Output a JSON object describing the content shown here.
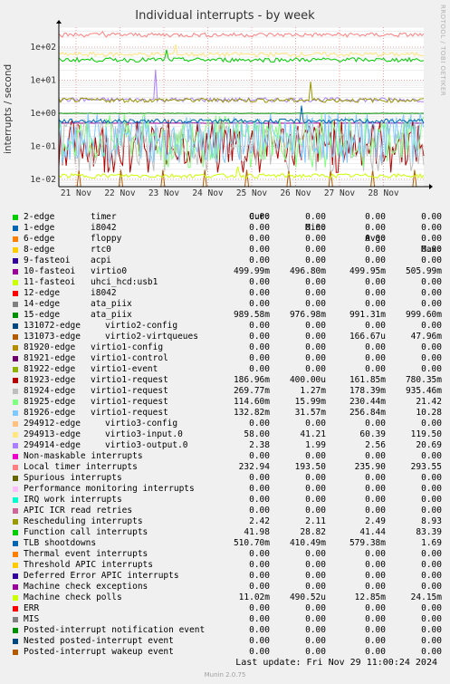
{
  "chart_data": {
    "type": "line",
    "title": "Individual interrupts - by week",
    "ylabel": "interrupts / second",
    "yscale": "log",
    "ylim": [
      0.006,
      400
    ],
    "y_ticks": [
      {
        "v": 100,
        "label": "1e+02"
      },
      {
        "v": 10,
        "label": "1e+01"
      },
      {
        "v": 1,
        "label": "1e+00"
      },
      {
        "v": 0.1,
        "label": "1e-01"
      },
      {
        "v": 0.01,
        "label": "1e-02"
      }
    ],
    "x_ticks": [
      "21 Nov",
      "22 Nov",
      "23 Nov",
      "24 Nov",
      "25 Nov",
      "26 Nov",
      "27 Nov",
      "28 Nov"
    ],
    "grid": true,
    "legend_columns": [
      "Cur:",
      "Min:",
      "Avg:",
      "Max:"
    ],
    "series": [
      {
        "name": "2-edge",
        "desc": "timer",
        "color": "#00cc00",
        "cur": "0.00",
        "min": "0.00",
        "avg": "0.00",
        "max": "0.00"
      },
      {
        "name": "1-edge",
        "desc": "i8042",
        "color": "#0066b3",
        "cur": "0.00",
        "min": "0.00",
        "avg": "0.00",
        "max": "0.00"
      },
      {
        "name": "6-edge",
        "desc": "floppy",
        "color": "#ff8000",
        "cur": "0.00",
        "min": "0.00",
        "avg": "0.00",
        "max": "0.00"
      },
      {
        "name": "8-edge",
        "desc": "rtc0",
        "color": "#ffcc00",
        "cur": "0.00",
        "min": "0.00",
        "avg": "0.00",
        "max": "0.00"
      },
      {
        "name": "9-fasteoi",
        "desc": "acpi",
        "color": "#330099",
        "cur": "0.00",
        "min": "0.00",
        "avg": "0.00",
        "max": "0.00"
      },
      {
        "name": "10-fasteoi",
        "desc": "virtio0",
        "color": "#990099",
        "cur": "499.99m",
        "min": "496.80m",
        "avg": "499.95m",
        "max": "505.99m"
      },
      {
        "name": "11-fasteoi",
        "desc": "uhci_hcd:usb1",
        "color": "#ccff00",
        "cur": "0.00",
        "min": "0.00",
        "avg": "0.00",
        "max": "0.00"
      },
      {
        "name": "12-edge",
        "desc": "i8042",
        "color": "#ff0000",
        "cur": "0.00",
        "min": "0.00",
        "avg": "0.00",
        "max": "0.00"
      },
      {
        "name": "14-edge",
        "desc": "ata_piix",
        "color": "#808080",
        "cur": "0.00",
        "min": "0.00",
        "avg": "0.00",
        "max": "0.00"
      },
      {
        "name": "15-edge",
        "desc": "ata_piix",
        "color": "#008f00",
        "cur": "989.58m",
        "min": "976.98m",
        "avg": "991.31m",
        "max": "999.60m"
      },
      {
        "name": "131072-edge",
        "desc": "virtio2-config",
        "color": "#00487d",
        "cur": "0.00",
        "min": "0.00",
        "avg": "0.00",
        "max": "0.00"
      },
      {
        "name": "131073-edge",
        "desc": "virtio2-virtqueues",
        "color": "#b35a00",
        "cur": "0.00",
        "min": "0.00",
        "avg": "166.67u",
        "max": "47.96m"
      },
      {
        "name": "81920-edge",
        "desc": "virtio1-config",
        "color": "#b38f00",
        "cur": "0.00",
        "min": "0.00",
        "avg": "0.00",
        "max": "0.00"
      },
      {
        "name": "81921-edge",
        "desc": "virtio1-control",
        "color": "#6b006b",
        "cur": "0.00",
        "min": "0.00",
        "avg": "0.00",
        "max": "0.00"
      },
      {
        "name": "81922-edge",
        "desc": "virtio1-event",
        "color": "#8fb300",
        "cur": "0.00",
        "min": "0.00",
        "avg": "0.00",
        "max": "0.00"
      },
      {
        "name": "81923-edge",
        "desc": "virtio1-request",
        "color": "#b30000",
        "cur": "186.96m",
        "min": "400.00u",
        "avg": "161.85m",
        "max": "780.35m"
      },
      {
        "name": "81924-edge",
        "desc": "virtio1-request",
        "color": "#bebebe",
        "cur": "269.77m",
        "min": "1.27m",
        "avg": "178.39m",
        "max": "935.46m"
      },
      {
        "name": "81925-edge",
        "desc": "virtio1-request",
        "color": "#80ff80",
        "cur": "114.60m",
        "min": "15.99m",
        "avg": "230.44m",
        "max": "21.42"
      },
      {
        "name": "81926-edge",
        "desc": "virtio1-request",
        "color": "#80c9ff",
        "cur": "132.82m",
        "min": "31.57m",
        "avg": "256.84m",
        "max": "10.28"
      },
      {
        "name": "294912-edge",
        "desc": "virtio3-config",
        "color": "#ffc080",
        "cur": "0.00",
        "min": "0.00",
        "avg": "0.00",
        "max": "0.00"
      },
      {
        "name": "294913-edge",
        "desc": "virtio3-input.0",
        "color": "#ffe680",
        "cur": "58.00",
        "min": "41.21",
        "avg": "60.39",
        "max": "119.50"
      },
      {
        "name": "294914-edge",
        "desc": "virtio3-output.0",
        "color": "#aa80ff",
        "cur": "2.38",
        "min": "1.99",
        "avg": "2.56",
        "max": "20.69"
      },
      {
        "name": "Non-maskable interrupts",
        "desc": "",
        "color": "#ee00cc",
        "cur": "0.00",
        "min": "0.00",
        "avg": "0.00",
        "max": "0.00"
      },
      {
        "name": "Local timer interrupts",
        "desc": "",
        "color": "#ff8080",
        "cur": "232.94",
        "min": "193.50",
        "avg": "235.90",
        "max": "293.55"
      },
      {
        "name": "Spurious interrupts",
        "desc": "",
        "color": "#666600",
        "cur": "0.00",
        "min": "0.00",
        "avg": "0.00",
        "max": "0.00"
      },
      {
        "name": "Performance monitoring interrupts",
        "desc": "",
        "color": "#ffbfff",
        "cur": "0.00",
        "min": "0.00",
        "avg": "0.00",
        "max": "0.00"
      },
      {
        "name": "IRQ work interrupts",
        "desc": "",
        "color": "#00ffcc",
        "cur": "0.00",
        "min": "0.00",
        "avg": "0.00",
        "max": "0.00"
      },
      {
        "name": "APIC ICR read retries",
        "desc": "",
        "color": "#cc6699",
        "cur": "0.00",
        "min": "0.00",
        "avg": "0.00",
        "max": "0.00"
      },
      {
        "name": "Rescheduling interrupts",
        "desc": "",
        "color": "#999900",
        "cur": "2.42",
        "min": "2.11",
        "avg": "2.49",
        "max": "8.93"
      },
      {
        "name": "Function call interrupts",
        "desc": "",
        "color": "#00cc00",
        "cur": "41.98",
        "min": "28.82",
        "avg": "41.44",
        "max": "83.39"
      },
      {
        "name": "TLB shootdowns",
        "desc": "",
        "color": "#0066b3",
        "cur": "510.70m",
        "min": "410.49m",
        "avg": "579.38m",
        "max": "1.69"
      },
      {
        "name": "Thermal event interrupts",
        "desc": "",
        "color": "#ff8000",
        "cur": "0.00",
        "min": "0.00",
        "avg": "0.00",
        "max": "0.00"
      },
      {
        "name": "Threshold APIC interrupts",
        "desc": "",
        "color": "#ffcc00",
        "cur": "0.00",
        "min": "0.00",
        "avg": "0.00",
        "max": "0.00"
      },
      {
        "name": "Deferred Error APIC interrupts",
        "desc": "",
        "color": "#330099",
        "cur": "0.00",
        "min": "0.00",
        "avg": "0.00",
        "max": "0.00"
      },
      {
        "name": "Machine check exceptions",
        "desc": "",
        "color": "#990099",
        "cur": "0.00",
        "min": "0.00",
        "avg": "0.00",
        "max": "0.00"
      },
      {
        "name": "Machine check polls",
        "desc": "",
        "color": "#ccff00",
        "cur": "11.02m",
        "min": "490.52u",
        "avg": "12.85m",
        "max": "24.15m"
      },
      {
        "name": "ERR",
        "desc": "",
        "color": "#ff0000",
        "cur": "0.00",
        "min": "0.00",
        "avg": "0.00",
        "max": "0.00"
      },
      {
        "name": "MIS",
        "desc": "",
        "color": "#808080",
        "cur": "0.00",
        "min": "0.00",
        "avg": "0.00",
        "max": "0.00"
      },
      {
        "name": "Posted-interrupt notification event",
        "desc": "",
        "color": "#008f00",
        "cur": "0.00",
        "min": "0.00",
        "avg": "0.00",
        "max": "0.00"
      },
      {
        "name": "Nested posted-interrupt event",
        "desc": "",
        "color": "#00487d",
        "cur": "0.00",
        "min": "0.00",
        "avg": "0.00",
        "max": "0.00"
      },
      {
        "name": "Posted-interrupt wakeup event",
        "desc": "",
        "color": "#b35a00",
        "cur": "0.00",
        "min": "0.00",
        "avg": "0.00",
        "max": "0.00"
      }
    ]
  },
  "side_label": "RRDTOOL / TOBI OETIKER",
  "last_update": "Last update: Fri Nov 29 11:00:24 2024",
  "footer": "Munin 2.0.75"
}
